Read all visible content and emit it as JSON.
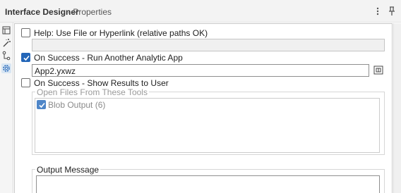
{
  "window": {
    "title": "Interface Designer",
    "subtitle": "- Properties"
  },
  "options": {
    "help_hyperlink": {
      "label": "Help: Use File or Hyperlink (relative paths OK)",
      "checked": false,
      "value": ""
    },
    "run_another_app": {
      "label": "On Success - Run Another Analytic App",
      "checked": true,
      "value": "App2.yxwz"
    },
    "show_results": {
      "label": "On Success - Show Results to User",
      "checked": false
    }
  },
  "open_files": {
    "title": "Open Files From These Tools",
    "items": [
      {
        "label": "Blob Output (6)",
        "checked": true
      }
    ]
  },
  "output_message": {
    "title": "Output Message",
    "value": ""
  },
  "icons": {
    "menu": "vertical-ellipsis-icon",
    "pin": "pin-icon",
    "sidebar": [
      "layout-icon",
      "magic-wand-icon",
      "tree-connector-icon",
      "gear-icon"
    ],
    "browse": "browse-file-icon"
  },
  "colors": {
    "accent": "#2466b8",
    "disabled_field": "#f0f0f0",
    "active_tab": "#d8e6f3"
  }
}
